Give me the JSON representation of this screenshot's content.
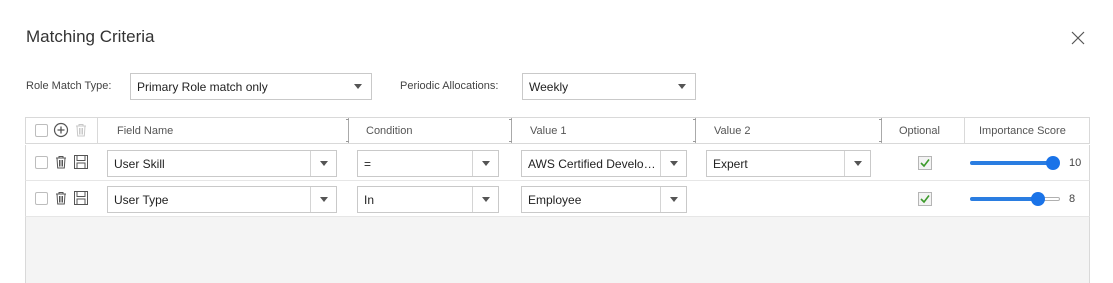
{
  "dialog": {
    "title": "Matching Criteria"
  },
  "filters": {
    "role_match_label": "Role Match Type:",
    "role_match_value": "Primary Role match only",
    "periodic_label": "Periodic Allocations:",
    "periodic_value": "Weekly"
  },
  "table": {
    "headers": {
      "field_name": "Field Name",
      "condition": "Condition",
      "value1": "Value 1",
      "value2": "Value 2",
      "optional": "Optional",
      "importance": "Importance Score"
    },
    "rows": [
      {
        "field": "User Skill",
        "condition": "=",
        "value1": "AWS Certified Develop...",
        "value2": "Expert",
        "optional": true,
        "score": "10",
        "score_fraction": 1.0
      },
      {
        "field": "User Type",
        "condition": "In",
        "value1": "Employee",
        "value2": "",
        "optional": true,
        "score": "8",
        "score_fraction": 0.8
      }
    ]
  },
  "icons": {
    "close": "close-icon",
    "add": "add-circle-icon",
    "delete": "trash-icon",
    "save": "save-icon",
    "dropdown": "chevron-down-icon",
    "check": "check-icon"
  },
  "colors": {
    "accent": "#1a73e8",
    "check": "#3c9a2b"
  }
}
